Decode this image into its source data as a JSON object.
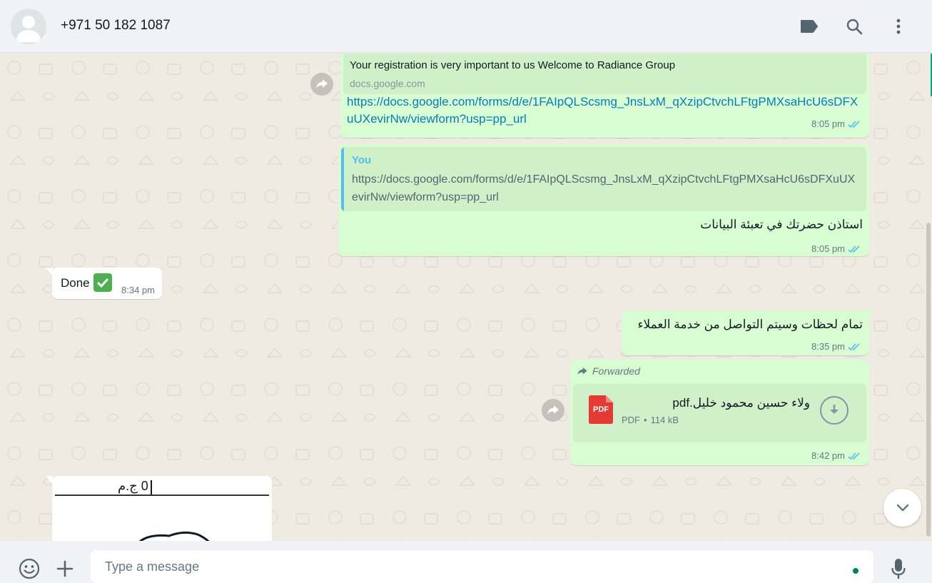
{
  "header": {
    "contact_name": "+971 50 182 1087",
    "icons": [
      "label-icon",
      "search-icon",
      "menu-icon"
    ]
  },
  "messages": {
    "m1": {
      "preview_title": "Your registration is very important to us Welcome to Radiance Group",
      "preview_domain": "docs.google.com",
      "link": "https://docs.google.com/forms/d/e/1FAIpQLScsmg_JnsLxM_qXzipCtvchLFtgPMXsaHcU6sDFXuUXevirNw/viewform?usp=pp_url",
      "time": "8:05 pm"
    },
    "m2": {
      "quote_author": "You",
      "quote_text": "https://docs.google.com/forms/d/e/1FAIpQLScsmg_JnsLxM_qXzipCtvchLFtgPMXsaHcU6sDFXuUXevirNw/viewform?usp=pp_url",
      "text": "استاذن حضرتك في تعبئة البيانات",
      "time": "8:05 pm"
    },
    "m3": {
      "text": "Done",
      "emoji": "✅",
      "time": "8:34 pm"
    },
    "m4": {
      "text": "تمام لحظات وسيتم التواصل من خدمة العملاء",
      "time": "8:35 pm"
    },
    "m5": {
      "forwarded_label": "Forwarded",
      "file_name": "ولاء حسين محمود خليل.pdf",
      "file_type_badge": "PDF",
      "file_type": "PDF",
      "file_size": "114 kB",
      "time": "8:42 pm"
    },
    "m6": {
      "image_text": "0 ج.م"
    }
  },
  "footer": {
    "placeholder": "Type a message"
  },
  "colors": {
    "outgoing": "#d9fdd3",
    "incoming": "#ffffff",
    "link": "#027eb5",
    "tick_read": "#53bdeb",
    "quote_accent": "#53bdeb",
    "pdf_red": "#e53935",
    "accent": "#00a884"
  }
}
